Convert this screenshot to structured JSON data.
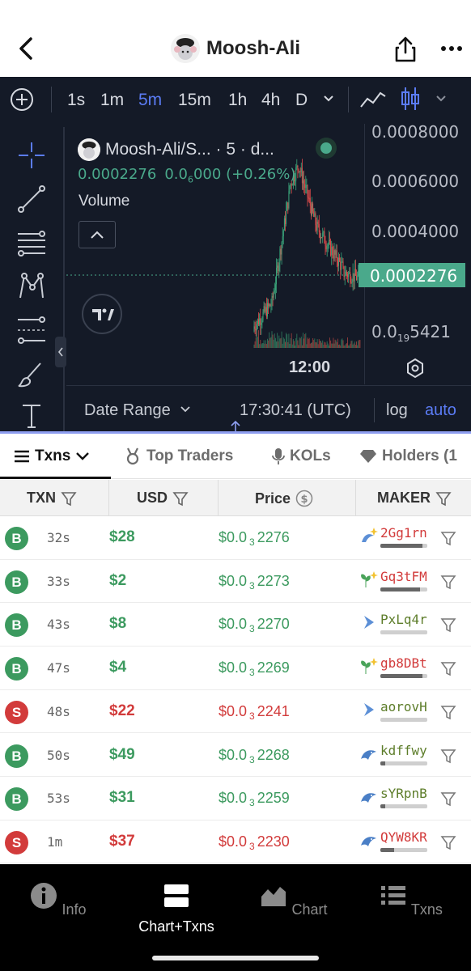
{
  "header": {
    "title": "Moosh-Ali"
  },
  "timeframes": [
    "1s",
    "1m",
    "5m",
    "15m",
    "1h",
    "4h",
    "D"
  ],
  "active_timeframe": "5m",
  "chart": {
    "symbol": "Moosh-Ali/S... · 5 · d...",
    "price": "0.0002276",
    "change_prefix": "0.0",
    "change_sub": "6",
    "change_suffix": "000 (+0.26%)",
    "volume_label": "Volume",
    "y_labels": [
      "0.0008000",
      "0.0006000",
      "0.0004000",
      "0.0002276",
      "0.0",
      "19",
      "5421"
    ],
    "x_label": "12:00",
    "date_range": "Date Range",
    "clock": "17:30:41 (UTC)",
    "log": "log",
    "auto": "auto"
  },
  "tabs": [
    {
      "label": "Txns"
    },
    {
      "label": "Top Traders"
    },
    {
      "label": "KOLs"
    },
    {
      "label": "Holders (1"
    }
  ],
  "columns": {
    "txn": "TXN",
    "usd": "USD",
    "price": "Price",
    "maker": "MAKER"
  },
  "rows": [
    {
      "type": "B",
      "age": "32s",
      "usd": "$28",
      "p1": "$0.0",
      "p2": "3",
      "p3": "2276",
      "maker": "2Gg1rn",
      "maker_color": "#d23b3b",
      "icon": "sparkle-dolphin-icon",
      "bar": 0.9
    },
    {
      "type": "B",
      "age": "33s",
      "usd": "$2",
      "p1": "$0.0",
      "p2": "3",
      "p3": "2273",
      "maker": "Gq3tFM",
      "maker_color": "#d23b3b",
      "icon": "sparkle-sprout-icon",
      "bar": 0.85
    },
    {
      "type": "B",
      "age": "43s",
      "usd": "$8",
      "p1": "$0.0",
      "p2": "3",
      "p3": "2270",
      "maker": "PxLq4r",
      "maker_color": "#5d7d2a",
      "icon": "blue-chevron-icon",
      "bar": 0
    },
    {
      "type": "B",
      "age": "47s",
      "usd": "$4",
      "p1": "$0.0",
      "p2": "3",
      "p3": "2269",
      "maker": "gb8DBt",
      "maker_color": "#d23b3b",
      "icon": "sparkle-sprout-icon",
      "bar": 0.9
    },
    {
      "type": "S",
      "age": "48s",
      "usd": "$22",
      "p1": "$0.0",
      "p2": "3",
      "p3": "2241",
      "maker": "aorovH",
      "maker_color": "#5d7d2a",
      "icon": "blue-chevron-icon",
      "bar": 0
    },
    {
      "type": "B",
      "age": "50s",
      "usd": "$49",
      "p1": "$0.0",
      "p2": "3",
      "p3": "2268",
      "maker": "kdffwy",
      "maker_color": "#5d7d2a",
      "icon": "dolphin-icon",
      "bar": 0.1
    },
    {
      "type": "B",
      "age": "53s",
      "usd": "$31",
      "p1": "$0.0",
      "p2": "3",
      "p3": "2259",
      "maker": "sYRpnB",
      "maker_color": "#5d7d2a",
      "icon": "dolphin-icon",
      "bar": 0.1
    },
    {
      "type": "S",
      "age": "1m",
      "usd": "$37",
      "p1": "$0.0",
      "p2": "3",
      "p3": "2230",
      "maker": "QYW8KR",
      "maker_color": "#d23b3b",
      "icon": "dolphin-icon",
      "bar": 0.3
    }
  ],
  "nav": [
    {
      "label": "Info"
    },
    {
      "label": "Chart+Txns"
    },
    {
      "label": "Chart"
    },
    {
      "label": "Txns"
    }
  ]
}
